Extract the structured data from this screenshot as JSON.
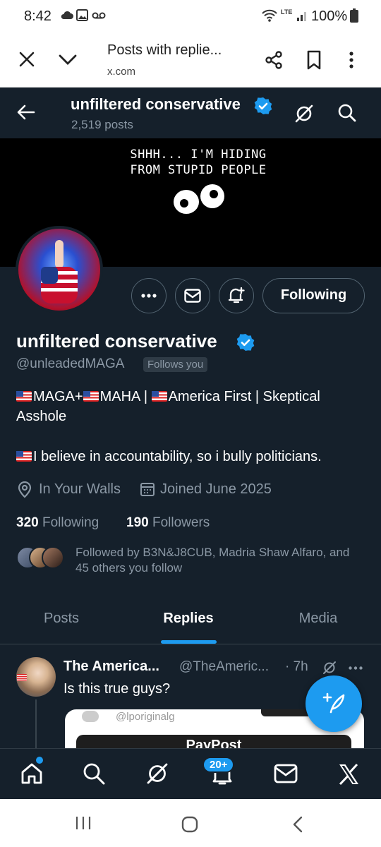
{
  "status_bar": {
    "time": "8:42",
    "battery": "100%",
    "net_label": "LTE"
  },
  "browser": {
    "title": "Posts with replie...",
    "url": "x.com"
  },
  "header": {
    "name": "unfiltered conservative",
    "post_count": "2,519 posts"
  },
  "banner": {
    "text_line1": "SHHH... I'M HIDING",
    "text_line2": "FROM STUPID PEOPLE"
  },
  "profile": {
    "following_button": "Following",
    "display_name": "unfiltered conservative",
    "handle": "@unleadedMAGA",
    "follows_you": "Follows you",
    "bio_part1": "MAGA+",
    "bio_part2": "MAHA | ",
    "bio_part3": "America First | Skeptical Asshole",
    "bio_line2": "I believe in accountability, so i bully politicians.",
    "location": "In Your Walls",
    "joined": "Joined June 2025",
    "following_count": "320",
    "following_label": "Following",
    "followers_count": "190",
    "followers_label": "Followers",
    "followed_by": "Followed by B3N&J8CUB, Madria Shaw Alfaro, and 45 others you follow"
  },
  "tabs": [
    {
      "label": "Posts",
      "active": false
    },
    {
      "label": "Replies",
      "active": true
    },
    {
      "label": "Media",
      "active": false
    }
  ],
  "post": {
    "author": "The America...",
    "handle": "@TheAmeric...",
    "time": "· 7h",
    "text": "Is this true guys?",
    "embed_handle": "@lporiginalg",
    "embed_title": "PayPost"
  },
  "bottom_nav": {
    "notifications_badge": "20+"
  },
  "colors": {
    "background": "#15202b",
    "accent": "#1d9bf0",
    "muted": "#8b98a5"
  }
}
